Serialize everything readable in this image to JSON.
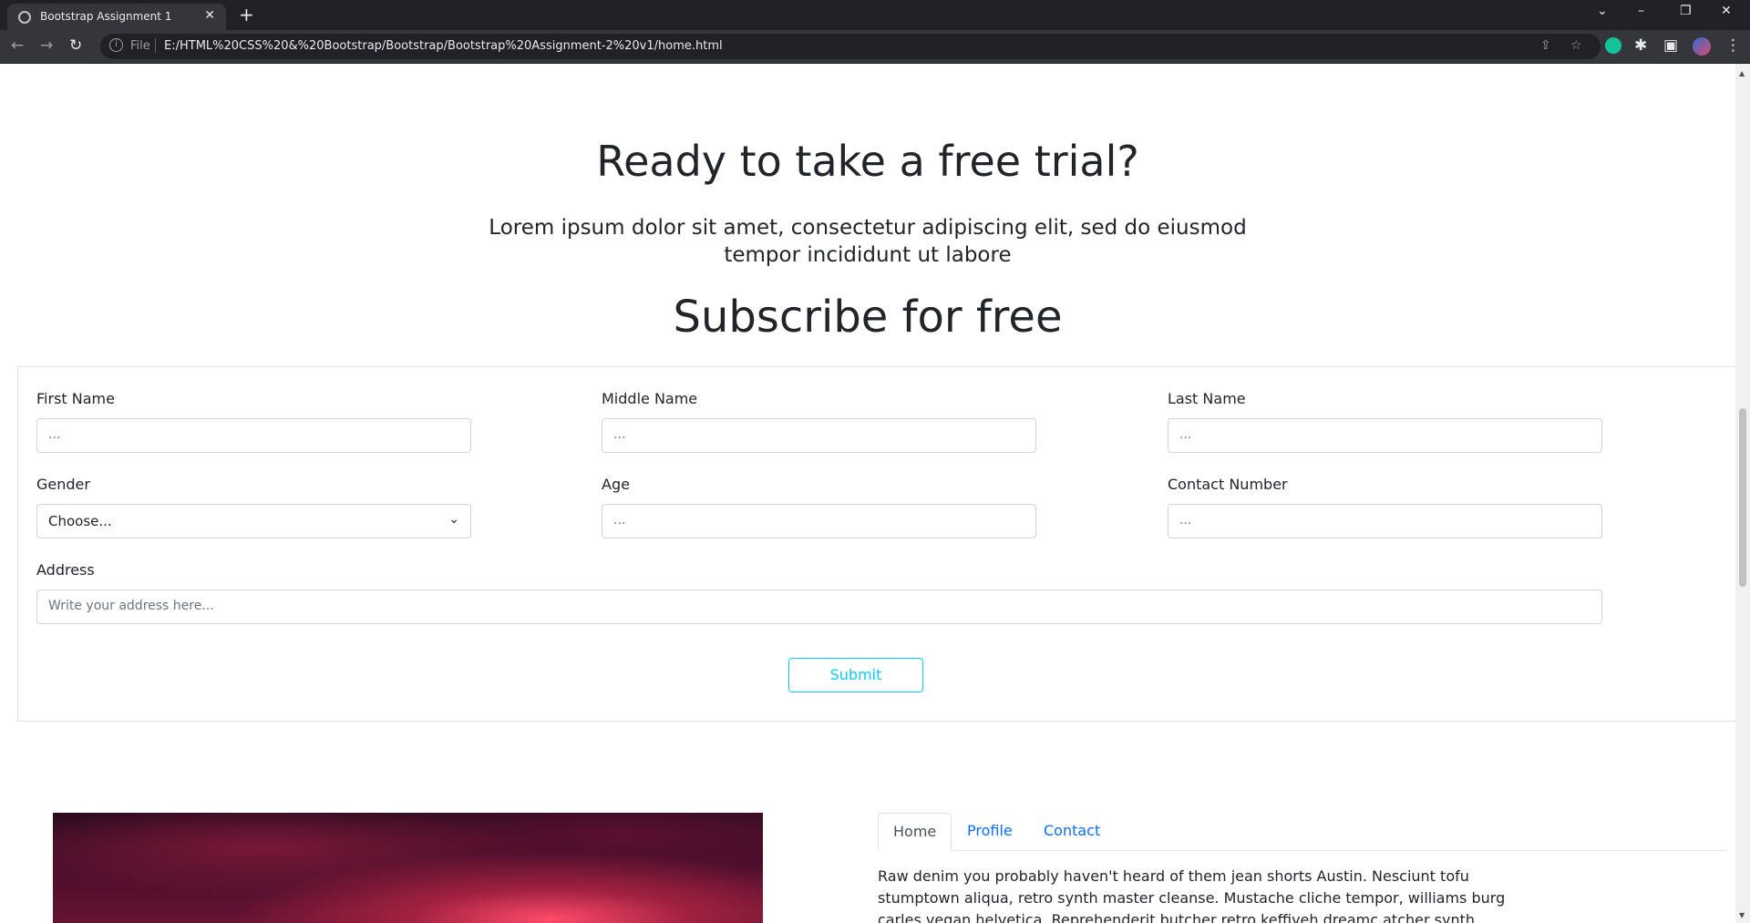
{
  "browser": {
    "tab_title": "Bootstrap Assignment 1",
    "tab_close": "✕",
    "new_tab": "+",
    "scheme": "File",
    "url": "E:/HTML%20CSS%20&%20Bootstrap/Bootstrap/Bootstrap%20Assignment-2%20v1/home.html"
  },
  "hero": {
    "title": "Ready to take a free trial?",
    "lead": "Lorem ipsum dolor sit amet, consectetur adipiscing elit, sed do eiusmod tempor incididunt ut labore",
    "subscribe_title": "Subscribe for free"
  },
  "form": {
    "first_name": {
      "label": "First Name",
      "placeholder": "..."
    },
    "middle_name": {
      "label": "Middle Name",
      "placeholder": "..."
    },
    "last_name": {
      "label": "Last Name",
      "placeholder": "..."
    },
    "gender": {
      "label": "Gender",
      "selected": "Choose..."
    },
    "age": {
      "label": "Age",
      "placeholder": "..."
    },
    "contact": {
      "label": "Contact Number",
      "placeholder": "..."
    },
    "address": {
      "label": "Address",
      "placeholder": "Write your address here..."
    },
    "submit_label": "Submit"
  },
  "tabs": {
    "items": [
      {
        "label": "Home",
        "active": true
      },
      {
        "label": "Profile",
        "active": false
      },
      {
        "label": "Contact",
        "active": false
      }
    ],
    "content": "Raw denim you probably haven't heard of them jean shorts Austin. Nesciunt tofu stumptown aliqua, retro synth master cleanse. Mustache cliche tempor, williams burg carles vegan helvetica. Reprehenderit butcher retro keffiyeh dreamc atcher synth."
  },
  "colors": {
    "accent": "#0dcaf0",
    "link": "#0d6efd",
    "chrome_bg": "#202124"
  }
}
